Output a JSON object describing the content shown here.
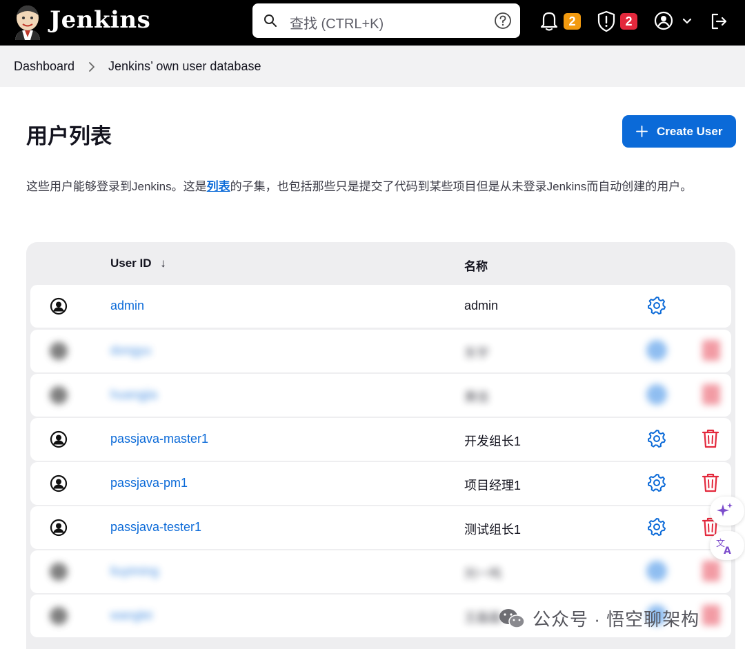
{
  "header": {
    "brand": "Jenkins",
    "search_placeholder": "查找 (CTRL+K)",
    "notifications_count": "2",
    "security_count": "2"
  },
  "breadcrumb": {
    "items": [
      "Dashboard",
      "Jenkins’ own user database"
    ]
  },
  "page": {
    "title": "用户列表",
    "create_button": "Create User",
    "description_before": "这些用户能够登录到Jenkins。这是",
    "description_link": "列表",
    "description_after": "的子集，也包括那些只是提交了代码到某些项目但是从未登录Jenkins而自动创建的用户。"
  },
  "table": {
    "columns": [
      "User ID",
      "名称"
    ],
    "sort_indicator": "↓",
    "rows": [
      {
        "user_id": "admin",
        "name": "admin"
      },
      {
        "user_id": "dongyu",
        "name": "东宇"
      },
      {
        "user_id": "huangjia",
        "name": "黄佳"
      },
      {
        "user_id": "passjava-master1",
        "name": "开发组长1"
      },
      {
        "user_id": "passjava-pm1",
        "name": "项目经理1"
      },
      {
        "user_id": "passjava-tester1",
        "name": "测试组长1"
      },
      {
        "user_id": "liuyiming",
        "name": "刘一鸣"
      },
      {
        "user_id": "wanglei",
        "name": "王磊磊"
      }
    ]
  },
  "watermark": "公众号 · 悟空聊架构",
  "colors": {
    "accent": "#0b6ad8",
    "danger": "#e3283c",
    "warning_badge": "#f29a0f",
    "header_bg": "#000000"
  }
}
